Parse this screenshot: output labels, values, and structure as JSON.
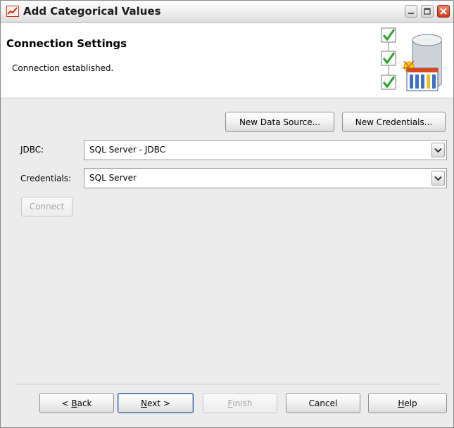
{
  "window": {
    "title": "Add Categorical Values"
  },
  "header": {
    "title": "Connection Settings",
    "status": "Connection established."
  },
  "buttons": {
    "new_data_source": "New Data Source...",
    "new_credentials": "New Credentials...",
    "connect": "Connect"
  },
  "fields": {
    "jdbc_label": "JDBC:",
    "jdbc_value": "SQL Server - JDBC",
    "credentials_label": "Credentials:",
    "credentials_value": "SQL Server"
  },
  "footer": {
    "back_mnemonic": "B",
    "back_rest": "ack",
    "back_prefix": "< ",
    "next_mnemonic": "N",
    "next_rest": "ext >",
    "finish_mnemonic": "F",
    "finish_rest": "inish",
    "cancel": "Cancel",
    "help_mnemonic": "H",
    "help_rest": "elp"
  },
  "colors": {
    "check_green": "#2ea02e",
    "close_red": "#cf3a1a"
  }
}
